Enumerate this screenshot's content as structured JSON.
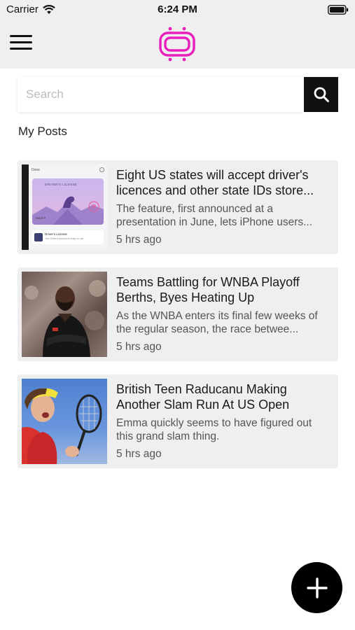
{
  "status_bar": {
    "carrier": "Carrier",
    "time": "6:24 PM"
  },
  "nav": {
    "menu_icon": "hamburger-menu-icon",
    "logo_icon": "tv-logo-icon",
    "logo_color": "#e91fbd"
  },
  "search": {
    "placeholder": "Search",
    "value": "",
    "button_icon": "search-icon"
  },
  "section_title": "My Posts",
  "posts": [
    {
      "title": "Eight US states will accept driver's licences and other state IDs store...",
      "summary": "The feature, first announced at a presentation in June, lets iPhone users...",
      "time": "5 hrs ago",
      "thumb": {
        "header_label": "Done",
        "card_label": "DRIVER'S LICENSE",
        "name_label": "Mark P.",
        "row_label": "Driver's License",
        "row_sub": "Your Driver's license is ready to use"
      }
    },
    {
      "title": "Teams Battling for WNBA Playoff Berths, Byes Heating Up",
      "summary": "As the WNBA enters its final few weeks of the regular season, the race betwee...",
      "time": "5 hrs ago"
    },
    {
      "title": "British Teen Raducanu Making Another Slam Run At US Open",
      "summary": "Emma quickly seems to have figured out this grand slam thing.",
      "time": "5 hrs ago"
    }
  ],
  "fab": {
    "icon": "plus-icon",
    "color": "#000000"
  }
}
